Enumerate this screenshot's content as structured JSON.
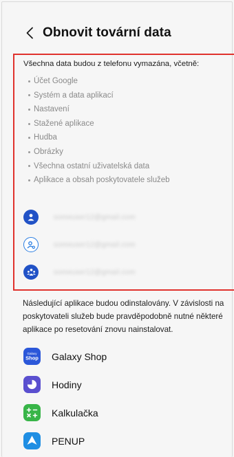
{
  "header": {
    "back_icon": "chevron-left-icon",
    "title": "Obnovit tovární data"
  },
  "data_section": {
    "intro": "Všechna data budou z telefonu vymazána, včetně:",
    "items": [
      "Účet Google",
      "Systém a data aplikací",
      "Nastavení",
      "Stažené aplikace",
      "Hudba",
      "Obrázky",
      "Všechna ostatní uživatelská data",
      "Aplikace a obsah poskytovatele služeb"
    ]
  },
  "accounts": [
    {
      "icon": "samsung-account-icon",
      "email": "someuser12@gmail.com"
    },
    {
      "icon": "user-settings-icon",
      "email": "someuser12@gmail.com"
    },
    {
      "icon": "family-icon",
      "email": "someuser12@gmail.com"
    }
  ],
  "apps_section": {
    "intro": "Následující aplikace budou odinstalovány. V závislosti na poskytovateli služeb bude pravděpodobně nutné některé aplikace po resetování znovu nainstalovat.",
    "apps": [
      {
        "label": "Galaxy Shop",
        "icon": "galaxy-shop-icon",
        "icon_small_text": "Galaxy",
        "icon_text": "Shop",
        "color": "#2b57d9"
      },
      {
        "label": "Hodiny",
        "icon": "clock-icon",
        "color": "#5a4fcf"
      },
      {
        "label": "Kalkulačka",
        "icon": "calculator-icon",
        "color": "#38b548"
      },
      {
        "label": "PENUP",
        "icon": "penup-icon",
        "color": "#1f8ee3"
      }
    ]
  },
  "colors": {
    "highlight": "#e0312c",
    "account_blue": "#2152c6"
  }
}
